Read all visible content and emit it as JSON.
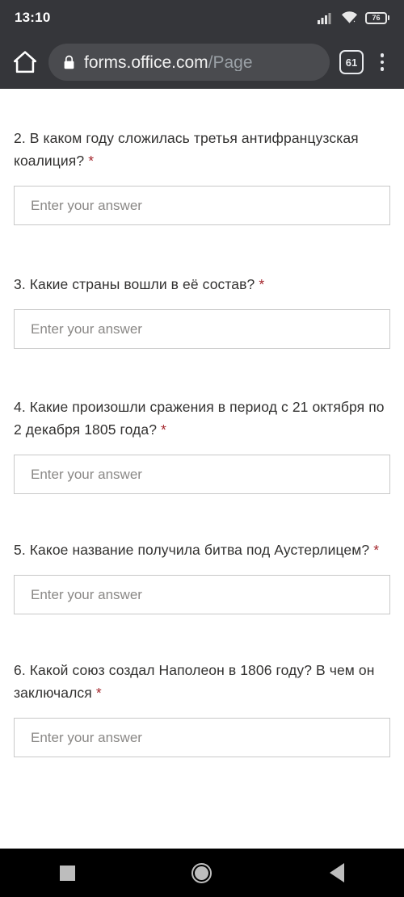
{
  "status_bar": {
    "time": "13:10",
    "battery_level": "76",
    "icons": [
      "signal-icon",
      "wifi-icon",
      "battery-icon"
    ]
  },
  "browser": {
    "home_icon": "home-icon",
    "lock_icon": "lock-icon",
    "url_host": "forms.office.com",
    "url_path": "/Page",
    "tab_count": "61",
    "menu_icon": "overflow-menu-icon"
  },
  "form": {
    "placeholder": "Enter your answer",
    "required_marker": "*",
    "questions": [
      {
        "text": "2. В каком году сложилась третья антифранцузская коалиция?",
        "required": true
      },
      {
        "text": "3. Какие страны вошли в её состав?",
        "required": true
      },
      {
        "text": "4. Какие произошли сражения в период с 21 октября по 2 декабря 1805 года?",
        "required": true
      },
      {
        "text": "5. Какое название получила битва под Аустерлицем?",
        "required": true
      },
      {
        "text": "6. Какой союз создал Наполеон в 1806 году? В чем он заключался",
        "required": true
      }
    ]
  },
  "nav_bar": {
    "recents_label": "Recent apps",
    "home_label": "Home",
    "back_label": "Back"
  },
  "colors": {
    "chrome_bg": "#35363a",
    "omnibox_bg": "#4a4b4f",
    "required_red": "#a4262c",
    "text": "#323130",
    "placeholder": "#8a8886",
    "nav_bg": "#000000"
  }
}
